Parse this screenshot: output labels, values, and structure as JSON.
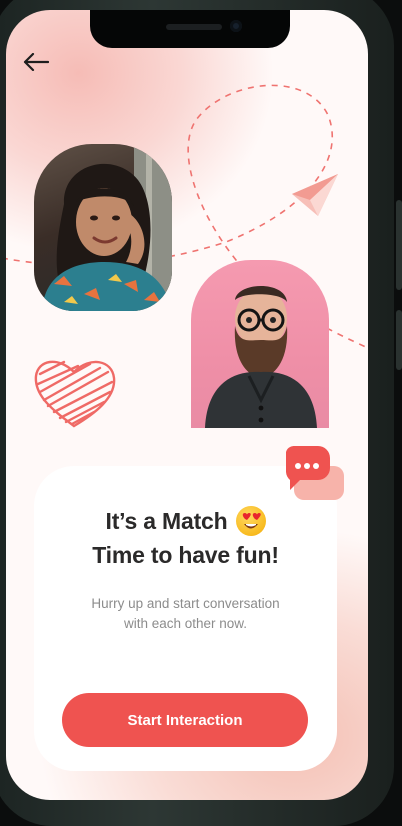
{
  "header": {
    "back_icon": "arrow-left-icon"
  },
  "profiles": [
    {
      "photo": "woman-portrait"
    },
    {
      "photo": "bearded-man-portrait"
    }
  ],
  "decorations": {
    "paper_plane_icon": "paper-plane-icon",
    "heart_icon": "scribble-heart-icon",
    "chat_icon": "chat-bubble-icon"
  },
  "match": {
    "title_line1": "It’s a Match",
    "title_emoji": "heart-eyes-emoji-icon",
    "title_line2": "Time to have fun!",
    "subtitle_line1": "Hurry up and start conversation",
    "subtitle_line2": "with each other now.",
    "cta_label": "Start Interaction"
  },
  "colors": {
    "accent": "#ef5350",
    "text_dark": "#2b2a2a",
    "text_muted": "#8c8c8c",
    "background_tint": "#f6bcb6"
  }
}
